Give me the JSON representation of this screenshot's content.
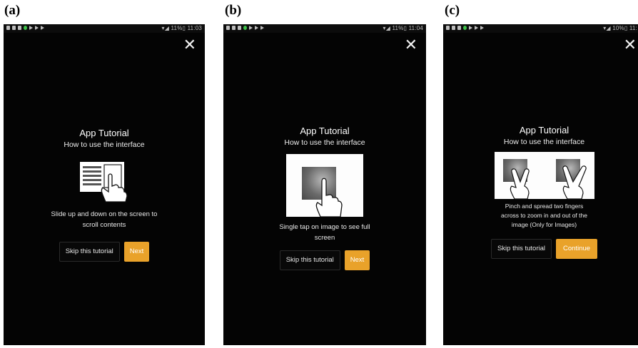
{
  "panels": [
    {
      "label": "(a)",
      "status_time": "11:03",
      "close_glyph": "✕",
      "title": "App Tutorial",
      "subtitle": "How to use the interface",
      "icon": "scroll-gesture-icon",
      "description_lines": [
        "Slide up and down on the screen to",
        "scroll contents"
      ],
      "skip_label": "Skip this tutorial",
      "action_label": "Next"
    },
    {
      "label": "(b)",
      "status_time": "11:04",
      "close_glyph": "✕",
      "title": "App Tutorial",
      "subtitle": "How to use the interface",
      "icon": "tap-gesture-icon",
      "description_lines": [
        "Single tap on image to see full",
        "screen"
      ],
      "skip_label": "Skip this tutorial",
      "action_label": "Next"
    },
    {
      "label": "(c)",
      "status_time": "11:",
      "close_glyph": "✕",
      "title": "App Tutorial",
      "subtitle": "How to use the interface",
      "icon": "pinch-spread-gesture-icon",
      "description_lines": [
        "Pinch and spread two fingers",
        "across to zoom in and out of the",
        "image (Only for Images)"
      ],
      "skip_label": "Skip this tutorial",
      "action_label": "Continue"
    }
  ],
  "colors": {
    "screen_bg": "#040404",
    "accent": "#e9a22a",
    "text": "#f1f1f1"
  }
}
